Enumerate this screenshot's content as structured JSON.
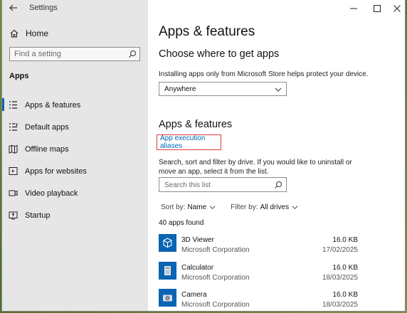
{
  "window": {
    "title": "Settings"
  },
  "sidebar": {
    "home_label": "Home",
    "search_placeholder": "Find a setting",
    "section": "Apps",
    "items": [
      {
        "label": "Apps & features",
        "icon": "list-icon",
        "active": true
      },
      {
        "label": "Default apps",
        "icon": "default-apps-icon"
      },
      {
        "label": "Offline maps",
        "icon": "map-icon"
      },
      {
        "label": "Apps for websites",
        "icon": "link-window-icon"
      },
      {
        "label": "Video playback",
        "icon": "video-icon"
      },
      {
        "label": "Startup",
        "icon": "startup-icon"
      }
    ]
  },
  "main": {
    "title": "Apps & features",
    "choose_heading": "Choose where to get apps",
    "choose_desc": "Installing apps only from Microsoft Store helps protect your device.",
    "source_value": "Anywhere",
    "section_heading": "Apps & features",
    "alias_link": "App execution aliases",
    "search_desc": "Search, sort and filter by drive. If you would like to uninstall or move an app, select it from the list.",
    "list_search_placeholder": "Search this list",
    "sort_label": "Sort by:",
    "sort_value": "Name",
    "filter_label": "Filter by:",
    "filter_value": "All drives",
    "count": "40 apps found",
    "apps": [
      {
        "name": "3D Viewer",
        "publisher": "Microsoft Corporation",
        "size": "16.0 KB",
        "date": "17/02/2025",
        "icon": "cube-icon"
      },
      {
        "name": "Calculator",
        "publisher": "Microsoft Corporation",
        "size": "16.0 KB",
        "date": "18/03/2025",
        "icon": "calculator-icon"
      },
      {
        "name": "Camera",
        "publisher": "Microsoft Corporation",
        "size": "16.0 KB",
        "date": "18/03/2025",
        "icon": "camera-icon"
      }
    ]
  },
  "colors": {
    "accent": "#0a64b4",
    "highlight_border": "#e23b3b",
    "sidebar_bg": "#e6e6e6"
  }
}
